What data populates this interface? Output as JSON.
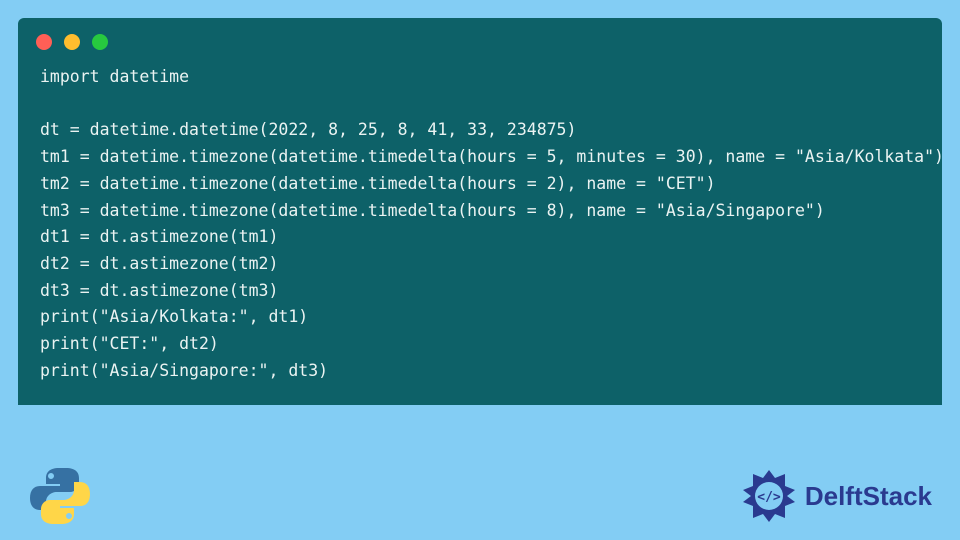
{
  "window": {
    "dots": [
      "red",
      "yellow",
      "green"
    ]
  },
  "code": {
    "lines": [
      "import datetime",
      "",
      "dt = datetime.datetime(2022, 8, 25, 8, 41, 33, 234875)",
      "tm1 = datetime.timezone(datetime.timedelta(hours = 5, minutes = 30), name = \"Asia/Kolkata\")",
      "tm2 = datetime.timezone(datetime.timedelta(hours = 2), name = \"CET\")",
      "tm3 = datetime.timezone(datetime.timedelta(hours = 8), name = \"Asia/Singapore\")",
      "dt1 = dt.astimezone(tm1)",
      "dt2 = dt.astimezone(tm2)",
      "dt3 = dt.astimezone(tm3)",
      "print(\"Asia/Kolkata:\", dt1)",
      "print(\"CET:\", dt2)",
      "print(\"Asia/Singapore:\", dt3)"
    ]
  },
  "footer": {
    "brand": "DelftStack"
  },
  "colors": {
    "page_bg": "#83cdf4",
    "window_bg": "#0d6168",
    "code_fg": "#eaf3f2",
    "brand": "#2a3a8f"
  }
}
